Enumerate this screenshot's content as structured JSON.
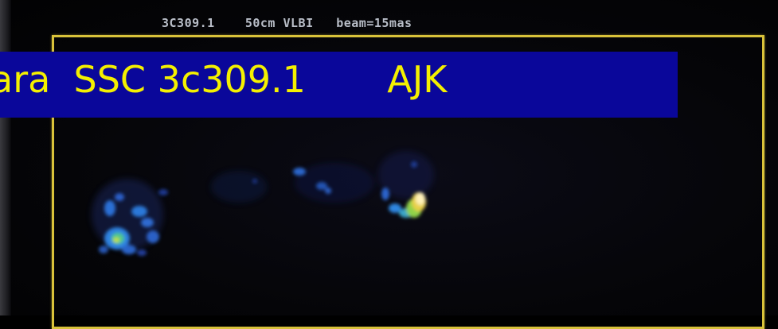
{
  "monitor_title": "3C309.1    50cm VLBI   beam=15mas",
  "caption": "ara  SSC 3c309.1       AJK",
  "colors": {
    "frame": "#d9c23a",
    "banner": "#0a079a",
    "caption_text": "#f4f000",
    "background": "#050508"
  }
}
